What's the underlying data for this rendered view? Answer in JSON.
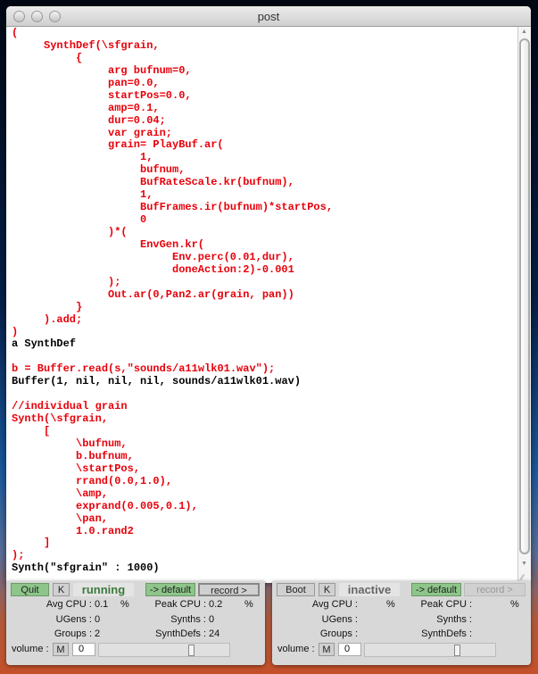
{
  "window": {
    "title": "post"
  },
  "colors": {
    "code": "#e8000a",
    "output": "#000000",
    "running": "#3c7a3c",
    "inactive": "#666666"
  },
  "lines": [
    {
      "i": 0,
      "c": "red",
      "t": "("
    },
    {
      "i": 1,
      "c": "red",
      "t": "SynthDef(\\sfgrain,"
    },
    {
      "i": 2,
      "c": "red",
      "t": "{"
    },
    {
      "i": 3,
      "c": "red",
      "t": "arg bufnum=0,"
    },
    {
      "i": 3,
      "c": "red",
      "t": "pan=0.0,"
    },
    {
      "i": 3,
      "c": "red",
      "t": "startPos=0.0,"
    },
    {
      "i": 3,
      "c": "red",
      "t": "amp=0.1,"
    },
    {
      "i": 3,
      "c": "red",
      "t": "dur=0.04;"
    },
    {
      "i": 3,
      "c": "red",
      "t": "var grain;"
    },
    {
      "i": 3,
      "c": "red",
      "t": "grain= PlayBuf.ar("
    },
    {
      "i": 4,
      "c": "red",
      "t": "1,"
    },
    {
      "i": 4,
      "c": "red",
      "t": "bufnum,"
    },
    {
      "i": 4,
      "c": "red",
      "t": "BufRateScale.kr(bufnum),"
    },
    {
      "i": 4,
      "c": "red",
      "t": "1,"
    },
    {
      "i": 4,
      "c": "red",
      "t": "BufFrames.ir(bufnum)*startPos,"
    },
    {
      "i": 4,
      "c": "red",
      "t": "0"
    },
    {
      "i": 3,
      "c": "red",
      "t": ")*("
    },
    {
      "i": 4,
      "c": "red",
      "t": "EnvGen.kr("
    },
    {
      "i": 5,
      "c": "red",
      "t": "Env.perc(0.01,dur),"
    },
    {
      "i": 5,
      "c": "red",
      "t": "doneAction:2)-0.001"
    },
    {
      "i": 3,
      "c": "red",
      "t": ");"
    },
    {
      "i": 3,
      "c": "red",
      "t": "Out.ar(0,Pan2.ar(grain, pan))"
    },
    {
      "i": 2,
      "c": "red",
      "t": "}"
    },
    {
      "i": 1,
      "c": "red",
      "t": ").add;"
    },
    {
      "i": 0,
      "c": "red",
      "t": ")"
    },
    {
      "i": 0,
      "c": "blk",
      "t": "a SynthDef"
    },
    {
      "i": 0,
      "c": "blk",
      "t": ""
    },
    {
      "i": 0,
      "c": "red",
      "t": "b = Buffer.read(s,\"sounds/a11wlk01.wav\");"
    },
    {
      "i": 0,
      "c": "blk",
      "t": "Buffer(1, nil, nil, nil, sounds/a11wlk01.wav)"
    },
    {
      "i": 0,
      "c": "blk",
      "t": ""
    },
    {
      "i": 0,
      "c": "red",
      "t": "//individual grain"
    },
    {
      "i": 0,
      "c": "red",
      "t": "Synth(\\sfgrain,"
    },
    {
      "i": 1,
      "c": "red",
      "t": "["
    },
    {
      "i": 2,
      "c": "red",
      "t": "\\bufnum,"
    },
    {
      "i": 2,
      "c": "red",
      "t": "b.bufnum,"
    },
    {
      "i": 2,
      "c": "red",
      "t": "\\startPos,"
    },
    {
      "i": 2,
      "c": "red",
      "t": "rrand(0.0,1.0),"
    },
    {
      "i": 2,
      "c": "red",
      "t": "\\amp,"
    },
    {
      "i": 2,
      "c": "red",
      "t": "exprand(0.005,0.1),"
    },
    {
      "i": 2,
      "c": "red",
      "t": "\\pan,"
    },
    {
      "i": 2,
      "c": "red",
      "t": "1.0.rand2"
    },
    {
      "i": 1,
      "c": "red",
      "t": "]"
    },
    {
      "i": 0,
      "c": "red",
      "t": ");"
    },
    {
      "i": 0,
      "c": "blk",
      "t": "Synth(\"sfgrain\" : 1000)"
    }
  ],
  "servers": [
    {
      "boot": "Quit",
      "kill": "K",
      "status": "running",
      "default": "-> default",
      "record": "record >",
      "avg_cpu_label": "Avg CPU :",
      "avg_cpu": "0.1",
      "pct": "%",
      "peak_cpu_label": "Peak CPU :",
      "peak_cpu": "0.2",
      "ugens_label": "UGens :",
      "ugens": "0",
      "synths_label": "Synths :",
      "synths": "0",
      "groups_label": "Groups :",
      "groups": "2",
      "synthdefs_label": "SynthDefs :",
      "synthdefs": "24",
      "volume_label": "volume :",
      "mute": "M",
      "volume": "0",
      "volume_level": 0.72
    },
    {
      "boot": "Boot",
      "kill": "K",
      "status": "inactive",
      "default": "-> default",
      "record": "record >",
      "avg_cpu_label": "Avg CPU :",
      "avg_cpu": "",
      "pct": "%",
      "peak_cpu_label": "Peak CPU :",
      "peak_cpu": "",
      "ugens_label": "UGens :",
      "ugens": "",
      "synths_label": "Synths :",
      "synths": "",
      "groups_label": "Groups :",
      "groups": "",
      "synthdefs_label": "SynthDefs :",
      "synthdefs": "",
      "volume_label": "volume :",
      "mute": "M",
      "volume": "0",
      "volume_level": 0.72
    }
  ]
}
